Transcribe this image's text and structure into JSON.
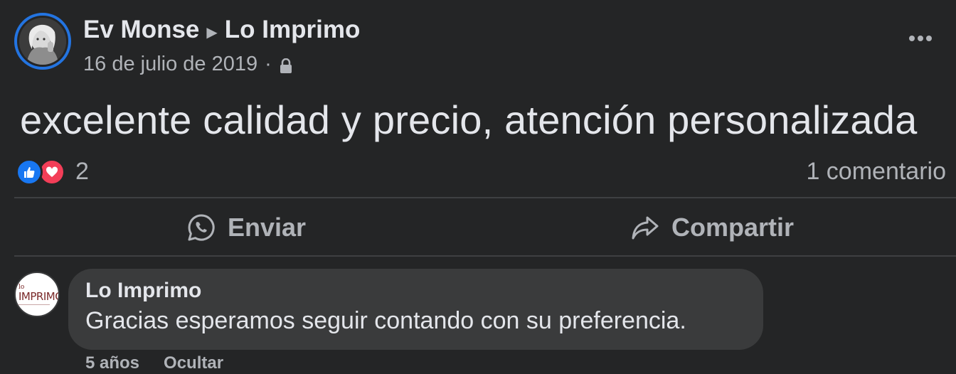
{
  "post": {
    "author": "Ev Monse",
    "page": "Lo Imprimo",
    "date": "16 de julio de 2019",
    "separator": "·",
    "text": "excelente calidad y precio, atención personalizada",
    "privacy_icon": "lock-icon",
    "more_icon": "more-options-icon"
  },
  "reactions": {
    "icons": [
      "like-icon",
      "love-icon"
    ],
    "count": "2",
    "comments": "1 comentario"
  },
  "actions": {
    "send_label": "Enviar",
    "send_icon": "whatsapp-icon",
    "share_label": "Compartir",
    "share_icon": "share-arrow-icon"
  },
  "comment": {
    "author": "Lo Imprimo",
    "text": "Gracias esperamos seguir contando con su preferencia.",
    "time": "5 años",
    "hide_label": "Ocultar",
    "avatar_logo_small": "lo",
    "avatar_logo_main": "IMPRIMO"
  },
  "colors": {
    "background": "#242526",
    "bubble": "#3a3b3c",
    "primary_text": "#e4e6eb",
    "secondary_text": "#b0b3b8",
    "avatar_ring": "#2374e1",
    "like": "#1877f2",
    "love": "#f33e58"
  }
}
